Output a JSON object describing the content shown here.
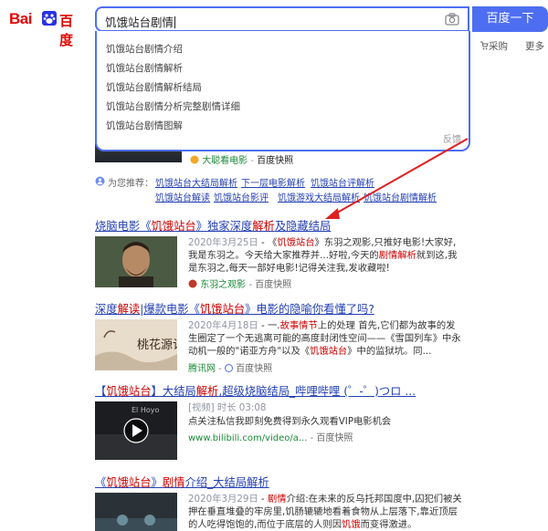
{
  "header": {
    "logo_bai": "Bai",
    "logo_du": "百度",
    "search_value": "饥饿站台剧情",
    "search_button": "百度一下",
    "caigou": "采购",
    "more": "更多"
  },
  "suggestions": [
    "饥饿站台剧情介绍",
    "饥饿站台剧情解析",
    "饥饿站台剧情解析结局",
    "饥饿站台剧情分析完整剧情详细",
    "饥饿站台剧情图解"
  ],
  "feedback": "反馈",
  "top_result": {
    "source": "大聪看电影",
    "sep": " - ",
    "cache": "百度快照"
  },
  "related": {
    "label": "为您推荐：",
    "items": [
      "饥饿站台大结局解析",
      "下一层电影解析",
      "饥饿站台评解析",
      "饥饿站台解读",
      "饥饿站台影评",
      "饥饿游戏大结局解析",
      "饥饿站台剧情解析"
    ]
  },
  "results": [
    {
      "title_pre": "烧脑电影《",
      "title_em1": "饥饿站台",
      "title_mid": "》独家深度",
      "title_em2": "解析",
      "title_post": "及隐藏结局",
      "date": "2020年3月25日",
      "body_a": " - 《",
      "body_em1": "饥饿站台",
      "body_b": "》东羽之观影,只推好电影!大家好,我是东羽之。今天给大家推荐并...好啦,今天的",
      "body_em2": "剧情解析",
      "body_c": "就到这,我是东羽之,每天一部好电影!记得关注我,发收藏啦!",
      "source": "东羽之观影",
      "cache": "百度快照"
    },
    {
      "title_pre": "深度",
      "title_em1": "解读",
      "title_mid": "|爆款电影《",
      "title_em2": "饥饿站台",
      "title_post": "》电影的隐喻你看懂了吗?",
      "date": "2020年4月18日",
      "body_a": " - 一.",
      "body_em1": "故事情节",
      "body_b": "上的处理 首先,它们都为故事的发生圈定了一个无逃离可能的高度封闭性空间——《雪国列车》中永动机一般的\"诺亚方舟\"以及《",
      "body_em2": "饥饿站台",
      "body_c": "》中的监狱坑。同...",
      "source": "腾讯网",
      "cache": "百度快照"
    },
    {
      "title_pre": "【",
      "title_em1": "饥饿站台",
      "title_mid": "】大结局",
      "title_em2": "解析",
      "title_post": ",超级烧脑结局_哔哩哔哩 (゜-゜)つロ ...",
      "date": "[视频] 时长 03:08",
      "body_a": "",
      "body_em1": "",
      "body_b": "点关注私信我即刻免费得到永久观看VIP电影机会",
      "body_em2": "",
      "body_c": "",
      "source": "www.bilibili.com/video/a...",
      "cache": "百度快照"
    },
    {
      "title_pre": "《",
      "title_em1": "饥饿站台",
      "title_mid": "》",
      "title_em2": "剧情",
      "title_post": "介绍_大结局解析",
      "date": "2020年3月29日",
      "body_a": " - ",
      "body_em1": "剧情",
      "body_b": "介绍:在未来的反乌托邦国度中,囚犯们被关押在垂直堆叠的牢房里,饥肠辘辘地看着食物从上层落下,靠近顶层的人吃得饱饱的,而位于底层的人则因",
      "body_em2": "饥饿",
      "body_c": "而变得激进。",
      "source": "",
      "cache": ""
    }
  ],
  "colors": {
    "accent": "#4e6ef2",
    "link": "#2440b3",
    "highlight": "#cc0000",
    "source_green": "#1a8a36"
  }
}
